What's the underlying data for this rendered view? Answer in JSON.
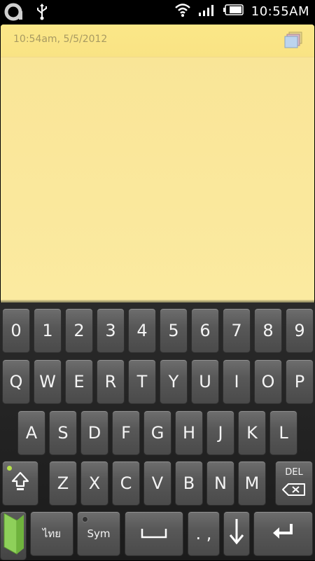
{
  "status_bar": {
    "time": "10:55AM",
    "icons": [
      "app-logo-icon",
      "usb-icon",
      "wifi-icon",
      "signal-icon",
      "battery-icon"
    ]
  },
  "note": {
    "timestamp": "10:54am, 5/5/2012",
    "content": "",
    "background_color": "#fbeaa0",
    "menu_icon": "note-copy-icon"
  },
  "keyboard": {
    "row_numbers": [
      "0",
      "1",
      "2",
      "3",
      "4",
      "5",
      "6",
      "7",
      "8",
      "9"
    ],
    "row_qwerty": [
      "Q",
      "W",
      "E",
      "R",
      "T",
      "Y",
      "U",
      "I",
      "O",
      "P"
    ],
    "row_asdf": [
      "A",
      "S",
      "D",
      "F",
      "G",
      "H",
      "J",
      "K",
      "L"
    ],
    "row_zxcv": [
      "Z",
      "X",
      "C",
      "V",
      "B",
      "N",
      "M"
    ],
    "shift_icon": "shift-icon",
    "delete_label": "DEL",
    "delete_icon": "backspace-icon",
    "language_label": "ไทย",
    "sym_label": "Sym",
    "space_icon": "space-icon",
    "punct_label": ". ,",
    "hide_icon": "arrow-down-icon",
    "enter_icon": "enter-icon",
    "edge_icon": "keyboard-switch-icon",
    "indicator_color": "#b6e24a"
  }
}
